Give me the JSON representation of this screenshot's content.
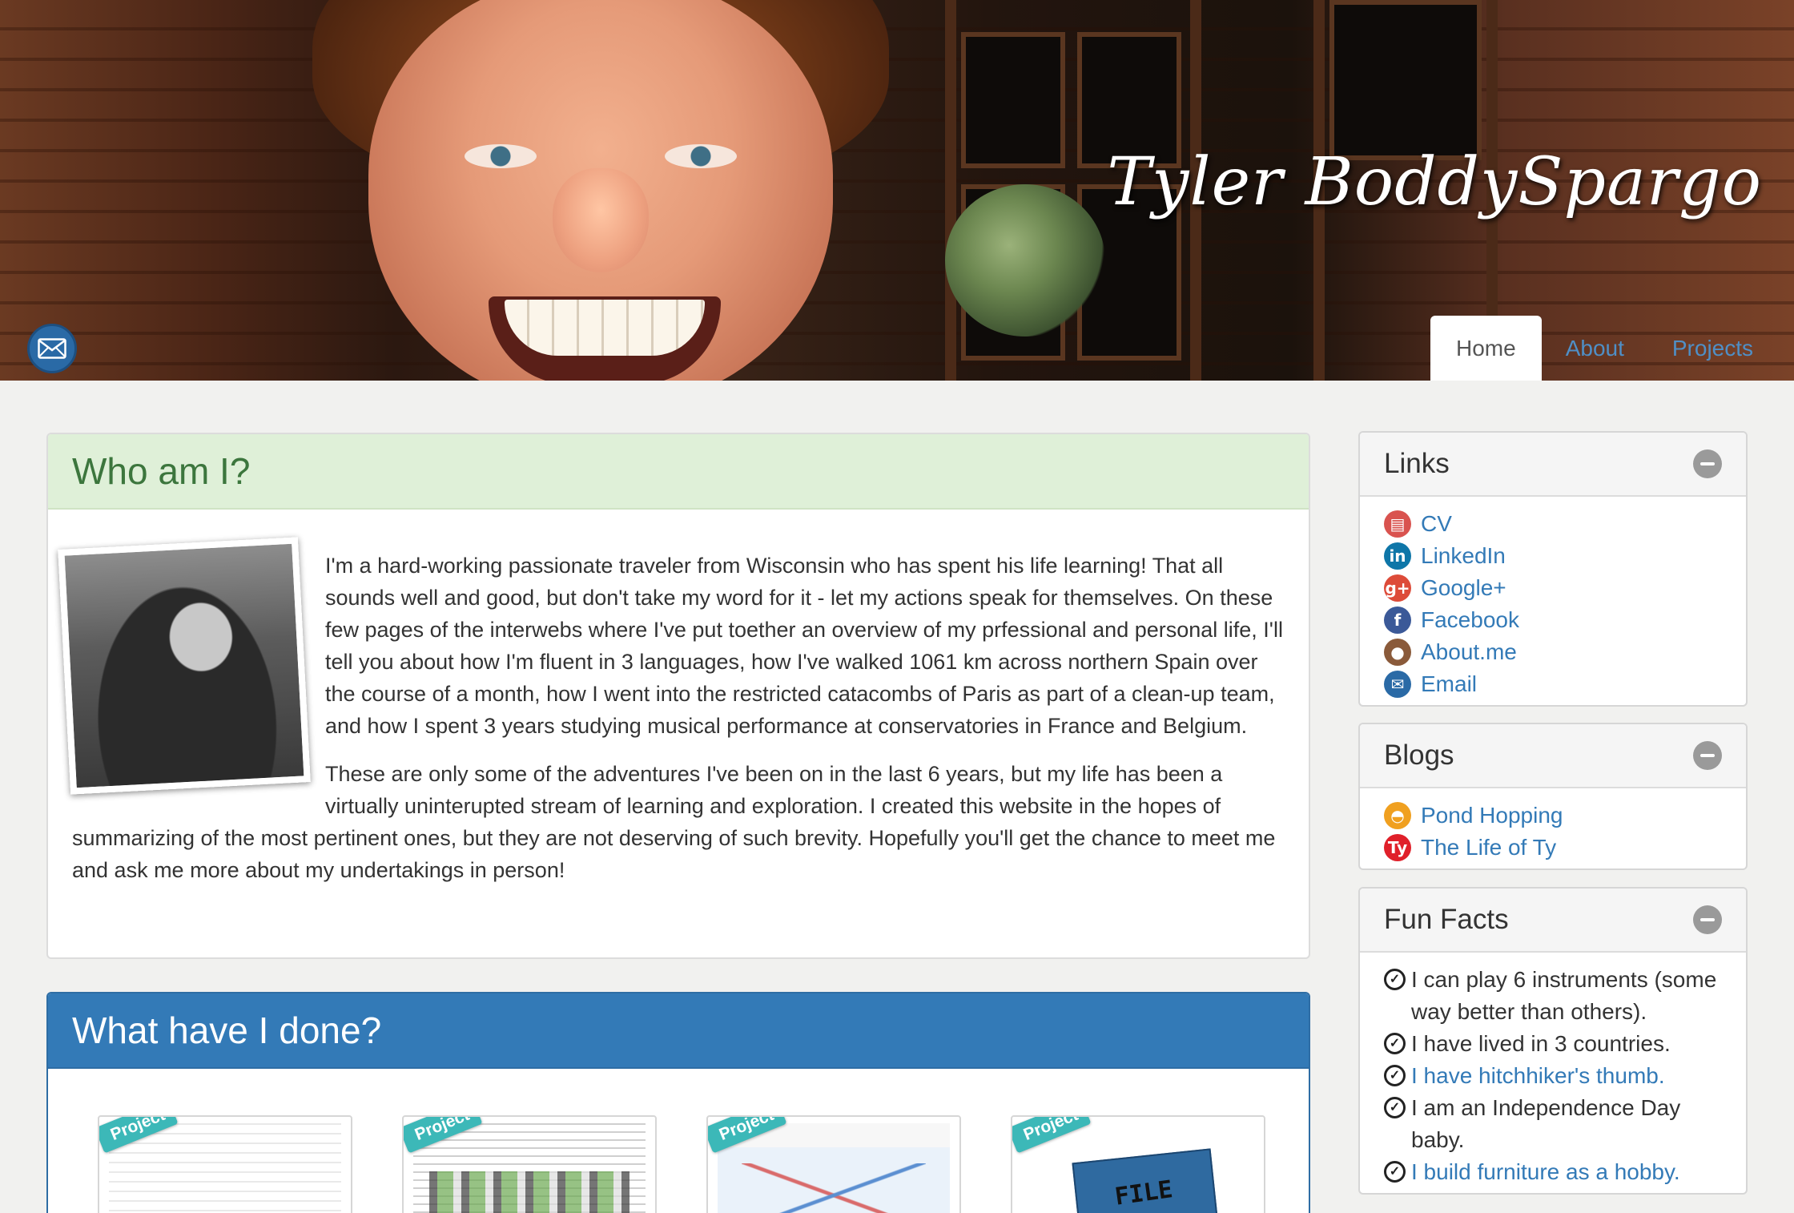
{
  "header": {
    "title": "Tyler BoddySpargo",
    "nav": [
      {
        "label": "Home",
        "active": true
      },
      {
        "label": "About",
        "active": false
      },
      {
        "label": "Projects",
        "active": false
      }
    ],
    "mail_icon": "envelope-icon"
  },
  "who": {
    "heading": "Who am I?",
    "paragraph1": "I'm a hard-working passionate traveler from Wisconsin who has spent his life learning! That all sounds well and good, but don't take my word for it - let my actions speak for themselves. On these few pages of the interwebs where I've put toether an overview of my prfessional and personal life, I'll tell you about how I'm fluent in 3 languages, how I've walked 1061 km across northern Spain over the course of a month, how I went into the restricted catacombs of Paris as part of a clean-up team, and how I spent 3 years studying musical performance at conservatories in France and Belgium.",
    "paragraph2": "These are only some of the adventures I've been on in the last 6 years, but my life has been a virtually uninterupted stream of learning and exploration. I created this website in the hopes of summarizing of the most pertinent ones, but they are not deserving of such brevity. Hopefully you'll get the chance to meet me and ask me more about my undertakings in person!"
  },
  "done": {
    "heading": "What have I done?",
    "ribbon": "Project",
    "file_label": "FILE"
  },
  "sidebar": {
    "links": {
      "title": "Links",
      "items": [
        {
          "label": "CV",
          "icon": "cv-icon",
          "color": "#d9534f",
          "glyph": "▤"
        },
        {
          "label": "LinkedIn",
          "icon": "linkedin-icon",
          "color": "#0e76a8",
          "glyph": "in"
        },
        {
          "label": "Google+",
          "icon": "google-plus-icon",
          "color": "#dd4b39",
          "glyph": "g+"
        },
        {
          "label": "Facebook",
          "icon": "facebook-icon",
          "color": "#3b5998",
          "glyph": "f"
        },
        {
          "label": "About.me",
          "icon": "aboutme-icon",
          "color": "#8a5a3a",
          "glyph": "●"
        },
        {
          "label": "Email",
          "icon": "email-icon",
          "color": "#2a6aa6",
          "glyph": "✉"
        }
      ]
    },
    "blogs": {
      "title": "Blogs",
      "items": [
        {
          "label": "Pond Hopping",
          "icon": "pond-hopping-icon",
          "color": "#f0a020",
          "glyph": "◓"
        },
        {
          "label": "The Life of Ty",
          "icon": "life-of-ty-icon",
          "color": "#e0202a",
          "glyph": "Ty"
        }
      ]
    },
    "funfacts": {
      "title": "Fun Facts",
      "items": [
        {
          "text": "I can play 6 instruments (some way better than others).",
          "link": false
        },
        {
          "text": "I have lived in 3 countries.",
          "link": false
        },
        {
          "text": "I have hitchhiker's thumb.",
          "link": true
        },
        {
          "text": "I am an Independence Day baby.",
          "link": false
        },
        {
          "text": "I build furniture as a hobby.",
          "link": true
        }
      ]
    }
  }
}
